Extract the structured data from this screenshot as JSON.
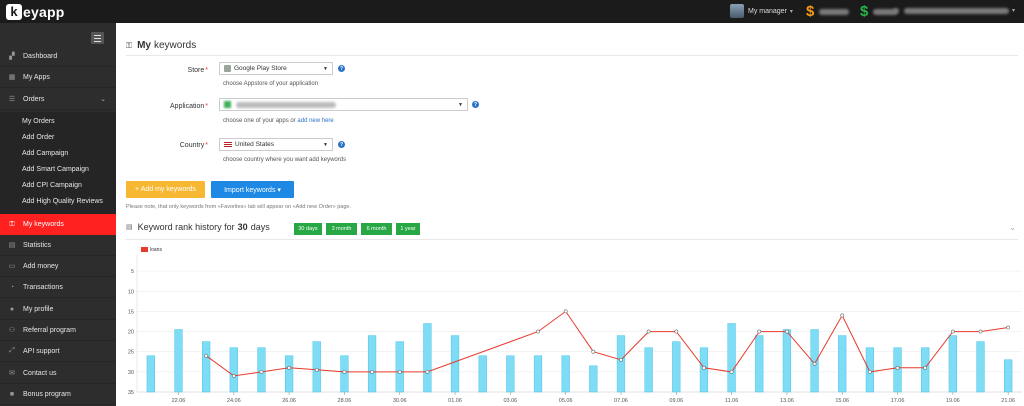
{
  "brand": {
    "logo_letter": "k",
    "logo_text": "eyapp"
  },
  "topbar": {
    "manager_label": "My manager",
    "balance_1_label": "$",
    "balance_2_label": "$"
  },
  "sidebar": {
    "items": [
      {
        "label": "Dashboard",
        "icon": "dashboard-icon"
      },
      {
        "label": "My Apps",
        "icon": "apps-icon"
      },
      {
        "label": "Orders",
        "icon": "orders-icon"
      },
      {
        "label": "My keywords",
        "icon": "key-icon"
      },
      {
        "label": "Statistics",
        "icon": "statistics-icon"
      },
      {
        "label": "Add money",
        "icon": "money-icon"
      },
      {
        "label": "Transactions",
        "icon": "transactions-icon"
      },
      {
        "label": "My profile",
        "icon": "user-icon"
      },
      {
        "label": "Referral program",
        "icon": "referral-icon"
      },
      {
        "label": "API support",
        "icon": "api-icon"
      },
      {
        "label": "Contact us",
        "icon": "mail-icon"
      },
      {
        "label": "Bonus program",
        "icon": "bonus-icon"
      }
    ],
    "order_subitems": [
      "My Orders",
      "Add Order",
      "Add Campaign",
      "Add Smart Campaign",
      "Add CPI Campaign",
      "Add High Quality Reviews"
    ],
    "active_color": "#ff2020"
  },
  "page": {
    "title_bold": "My",
    "title_rest": "keywords"
  },
  "form": {
    "store_label": "Store",
    "store_value": "Google Play Store",
    "store_hint": "choose Appstore of your application",
    "application_label": "Application",
    "application_hint": "choose one of your apps or",
    "application_hint_link": "add new here",
    "country_label": "Country",
    "country_value": "United States",
    "country_hint": "choose country where you want add keywords"
  },
  "buttons": {
    "add_keywords": "+ Add my keywords",
    "import_keywords": "Import keywords ▾"
  },
  "note": "Please note, that only keywords from «Favorites» tab will appear on «Add new Order» page.",
  "history": {
    "title_pre": "Keyword rank history for",
    "title_days": "30",
    "title_post": "days",
    "ranges": [
      "30 days",
      "3 month",
      "6 month",
      "1 year"
    ]
  },
  "chart_data": {
    "type": "line",
    "legend": [
      "loans"
    ],
    "y_inverted": true,
    "ylim": [
      1,
      35
    ],
    "yticks": [
      5,
      10,
      15,
      20,
      25,
      30,
      35
    ],
    "xticks": [
      "22.06",
      "24.06",
      "26.06",
      "28.06",
      "30.06",
      "01.06",
      "03.06",
      "05.06",
      "07.06",
      "09.06",
      "11.06",
      "13.06",
      "15.06",
      "17.06",
      "19.06",
      "21.06"
    ],
    "series": [
      {
        "name": "loans",
        "type": "line",
        "points": [
          [
            2,
            26
          ],
          [
            3,
            31
          ],
          [
            4,
            30
          ],
          [
            5,
            29
          ],
          [
            6,
            29.5
          ],
          [
            7,
            30
          ],
          [
            8,
            30
          ],
          [
            9,
            30
          ],
          [
            10,
            30
          ],
          [
            14,
            20
          ],
          [
            15,
            15
          ],
          [
            16,
            25
          ],
          [
            17,
            27
          ],
          [
            18,
            20
          ],
          [
            19,
            20
          ],
          [
            20,
            29
          ],
          [
            21,
            30
          ],
          [
            22,
            20
          ],
          [
            23,
            20
          ],
          [
            24,
            28
          ],
          [
            25,
            16
          ],
          [
            26,
            30
          ],
          [
            27,
            29
          ],
          [
            28,
            29
          ],
          [
            29,
            20
          ],
          [
            30,
            20
          ],
          [
            31,
            19
          ]
        ]
      },
      {
        "type": "bar",
        "values": [
          26,
          19.5,
          22.5,
          24,
          24,
          26,
          22.5,
          26,
          21,
          22.5,
          18,
          21,
          26,
          26,
          26,
          26,
          28.5,
          21,
          24,
          22.5,
          24,
          18,
          21,
          19.5,
          19.5,
          21,
          24,
          24,
          24,
          21,
          22.5,
          27
        ]
      }
    ],
    "colors": {
      "line": "#e8392b",
      "bar": "#7fdcf5",
      "bar_stroke": "#48c4ec"
    }
  }
}
